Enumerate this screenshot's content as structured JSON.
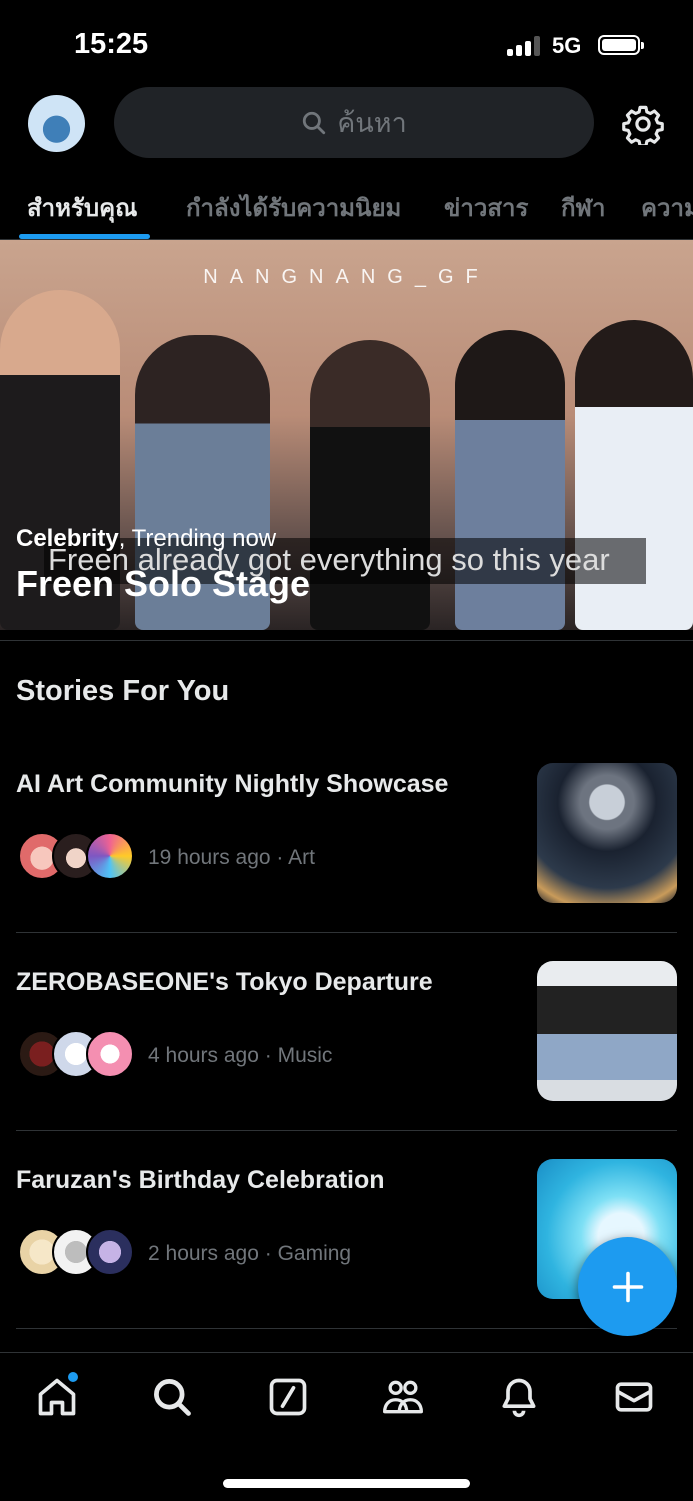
{
  "status_bar": {
    "time": "15:25",
    "network": "5G"
  },
  "header": {
    "search_placeholder": "ค้นหา"
  },
  "tabs": [
    {
      "label": "สำหรับคุณ"
    },
    {
      "label": "กำลังได้รับความนิยม"
    },
    {
      "label": "ข่าวสาร"
    },
    {
      "label": "กีฬา"
    },
    {
      "label": "ความ"
    }
  ],
  "hero": {
    "watermark": "NANGNANG_GF",
    "caption": "Freen already got everything so this year",
    "category": "Celebrity",
    "context": ", Trending now",
    "title": "Freen Solo Stage"
  },
  "stories": {
    "section_title": "Stories For You",
    "items": [
      {
        "title": "AI Art Community Nightly Showcase",
        "meta": "19 hours ago · Art"
      },
      {
        "title": "ZEROBASEONE's Tokyo Departure",
        "meta": "4 hours ago · Music"
      },
      {
        "title": "Faruzan's Birthday Celebration",
        "meta": "2 hours ago · Gaming"
      }
    ]
  },
  "colors": {
    "accent": "#1d9bf0",
    "background": "#000000",
    "muted": "#71767b"
  },
  "nav": {
    "items": [
      "home-icon",
      "search-icon",
      "grok-icon",
      "communities-icon",
      "notifications-icon",
      "messages-icon"
    ]
  }
}
